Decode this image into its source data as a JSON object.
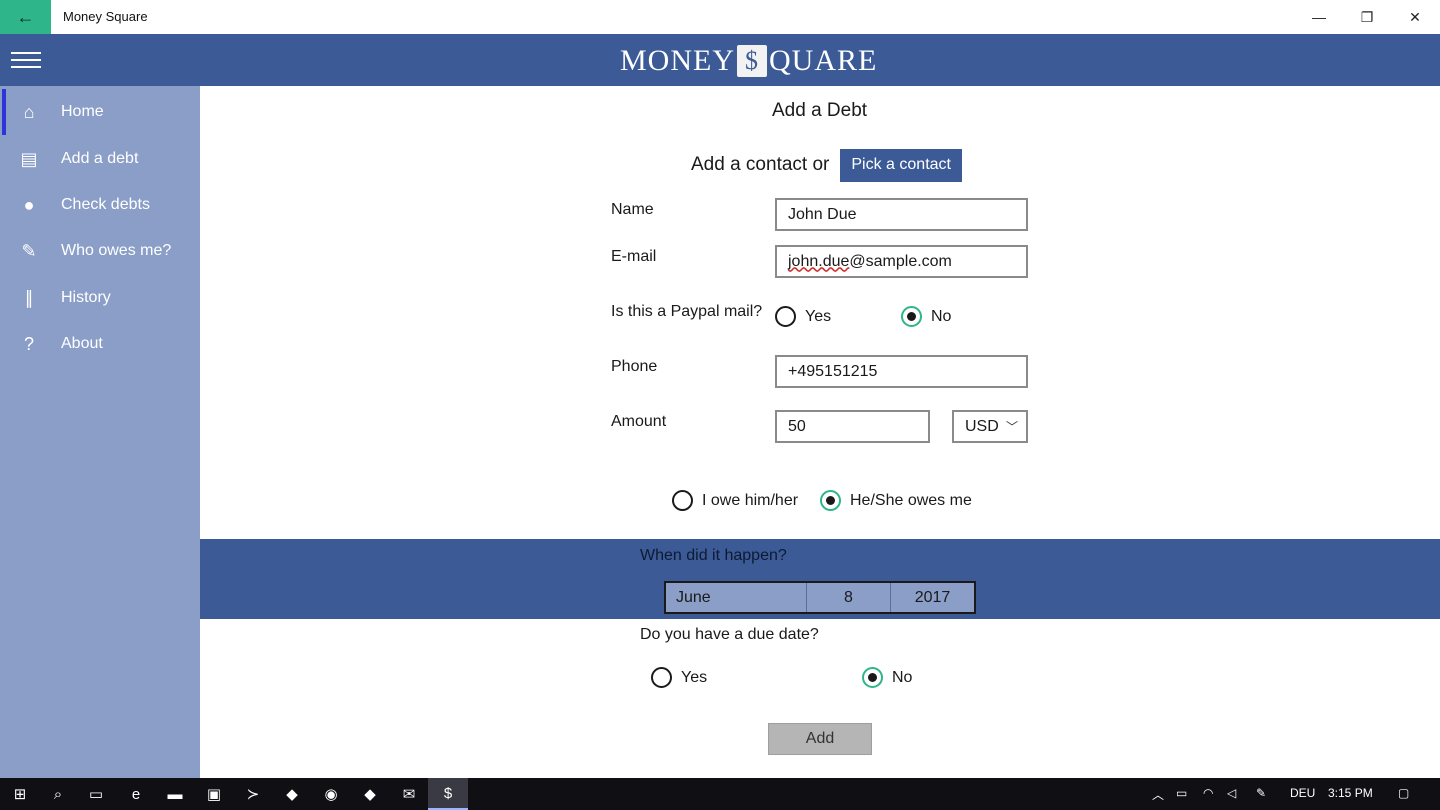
{
  "window": {
    "title": "Money Square",
    "back_icon": "←",
    "min_icon": "—",
    "max_icon": "❐",
    "close_icon": "✕"
  },
  "header": {
    "logo_left": "MONEY",
    "logo_mark": "$",
    "logo_right": "QUARE"
  },
  "sidebar": {
    "items": [
      {
        "label": "Home",
        "icon": "⌂"
      },
      {
        "label": "Add a debt",
        "icon": "▤"
      },
      {
        "label": "Check debts",
        "icon": "●"
      },
      {
        "label": "Who owes me?",
        "icon": "✎"
      },
      {
        "label": "History",
        "icon": "∥"
      },
      {
        "label": "About",
        "icon": "?"
      }
    ]
  },
  "form": {
    "title": "Add a Debt",
    "contact_text": "Add a contact or",
    "pick_contact": "Pick a contact",
    "name_label": "Name",
    "name_value": "John Due",
    "email_label": "E-mail",
    "email_value_prefix": "john.due",
    "email_value_suffix": "@sample.com",
    "paypal_label": "Is this a Paypal mail?",
    "paypal_yes": "Yes",
    "paypal_no": "No",
    "phone_label": "Phone",
    "phone_value": "+495151215",
    "amount_label": "Amount",
    "amount_value": "50",
    "currency": "USD",
    "chev": "﹀",
    "owe_option": "I owe him/her",
    "owed_option": "He/She owes me",
    "when_label": "When did it happen?",
    "date_month": "June",
    "date_day": "8",
    "date_year": "2017",
    "due_label": "Do you have a due date?",
    "due_yes": "Yes",
    "due_no": "No",
    "add_button": "Add"
  },
  "taskbar": {
    "language": "DEU",
    "time": "3:15 PM"
  }
}
